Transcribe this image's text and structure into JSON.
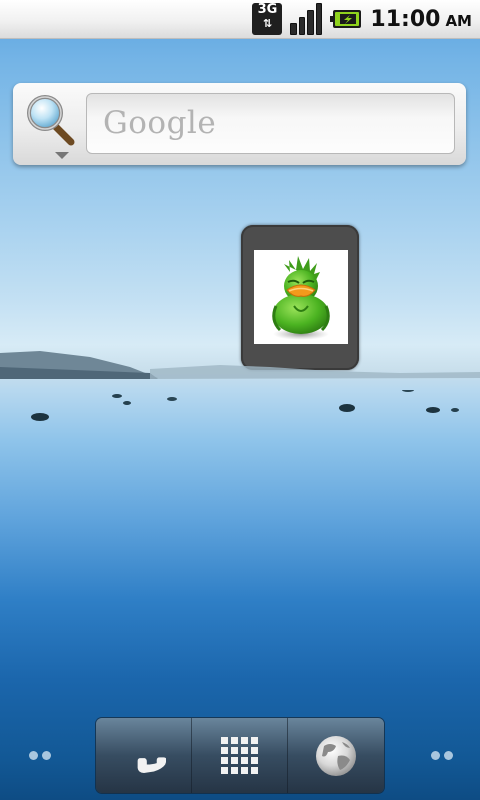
{
  "status_bar": {
    "network_type": "3G",
    "network_icon": "3g-data-icon",
    "signal_icon": "signal-strength-icon",
    "battery_icon": "battery-charging-icon",
    "time": "11:00",
    "ampm": "AM"
  },
  "search_widget": {
    "placeholder": "Google",
    "search_icon": "magnifier-icon",
    "dropdown_icon": "dropdown-triangle-icon"
  },
  "app_widget": {
    "icon": "green-duck-app-icon"
  },
  "dock": {
    "items": [
      {
        "icon": "phone-icon"
      },
      {
        "icon": "app-drawer-grid-icon"
      },
      {
        "icon": "browser-globe-icon"
      }
    ]
  },
  "colors": {
    "sky_top": "#5aa3df",
    "horizon": "#d7ebf6",
    "water_deep": "#0e4c84",
    "status_bar": "#f1f1f1",
    "battery_green": "#8fd21d"
  }
}
